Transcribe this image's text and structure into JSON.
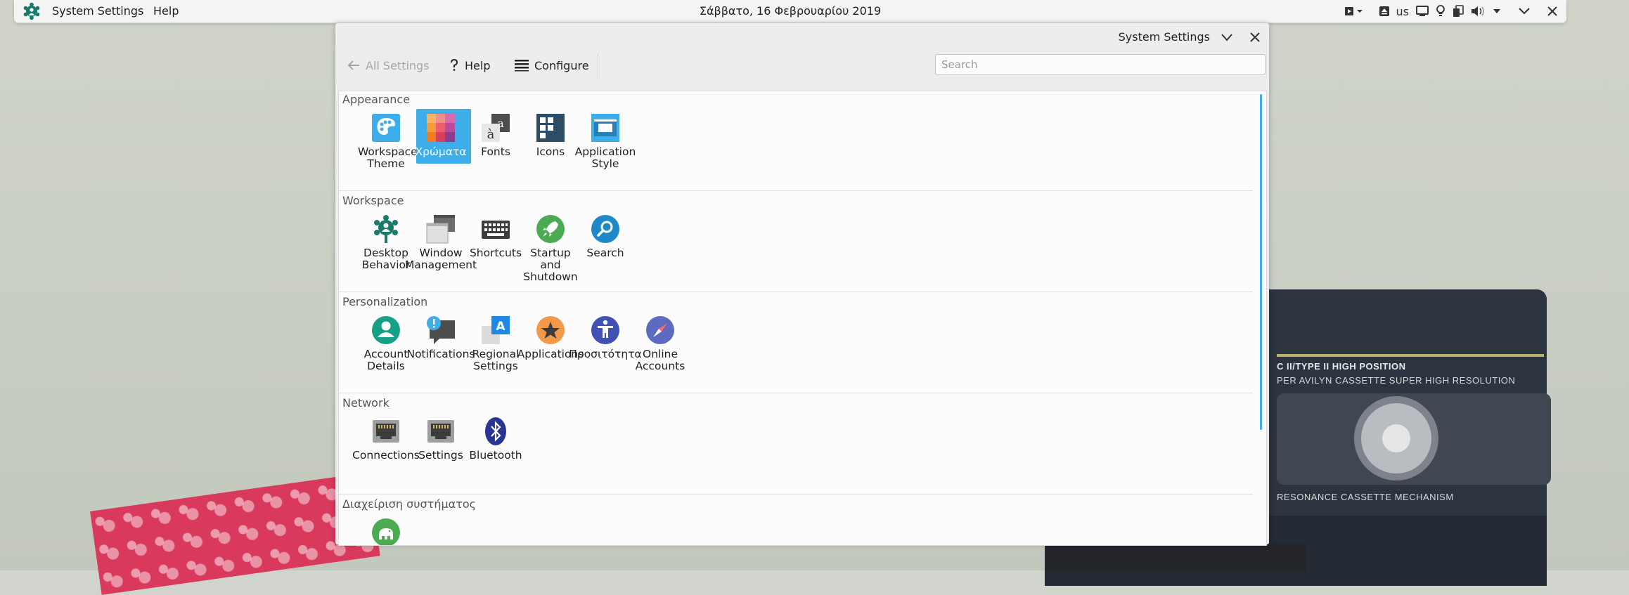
{
  "panel": {
    "app_name": "System Settings",
    "menu_help": "Help",
    "clock": "Σάββατο, 16 Φεβρουαρίου 2019",
    "keyboard_layout": "us"
  },
  "wallpaper": {
    "cassette_line1": "C II/TYPE II HIGH POSITION",
    "cassette_line2": "PER AVILYN CASSETTE SUPER HIGH RESOLUTION",
    "cassette_line3": "RESONANCE CASSETTE MECHANISM"
  },
  "window": {
    "title": "System Settings",
    "toolbar": {
      "all_settings": "All Settings",
      "help": "Help",
      "configure": "Configure"
    },
    "search_placeholder": "Search"
  },
  "sections": {
    "appearance": {
      "title": "Appearance",
      "items": [
        "Workspace Theme",
        "Χρώματα",
        "Fonts",
        "Icons",
        "Application Style"
      ]
    },
    "workspace": {
      "title": "Workspace",
      "items": [
        "Desktop Behavior",
        "Window Management",
        "Shortcuts",
        "Startup and Shutdown",
        "Search"
      ]
    },
    "personalization": {
      "title": "Personalization",
      "items": [
        "Account Details",
        "Notifications",
        "Regional Settings",
        "Applications",
        "Προσιτότητα",
        "Online Accounts"
      ]
    },
    "network": {
      "title": "Network",
      "items": [
        "Connections",
        "Settings",
        "Bluetooth"
      ]
    },
    "system_admin": {
      "title": "Διαχείριση συστήματος"
    }
  },
  "colors": {
    "accent": "#3daee9",
    "window_bg": "#ededed",
    "content_bg": "#fcfcfc"
  },
  "selected_item": "Χρώματα"
}
